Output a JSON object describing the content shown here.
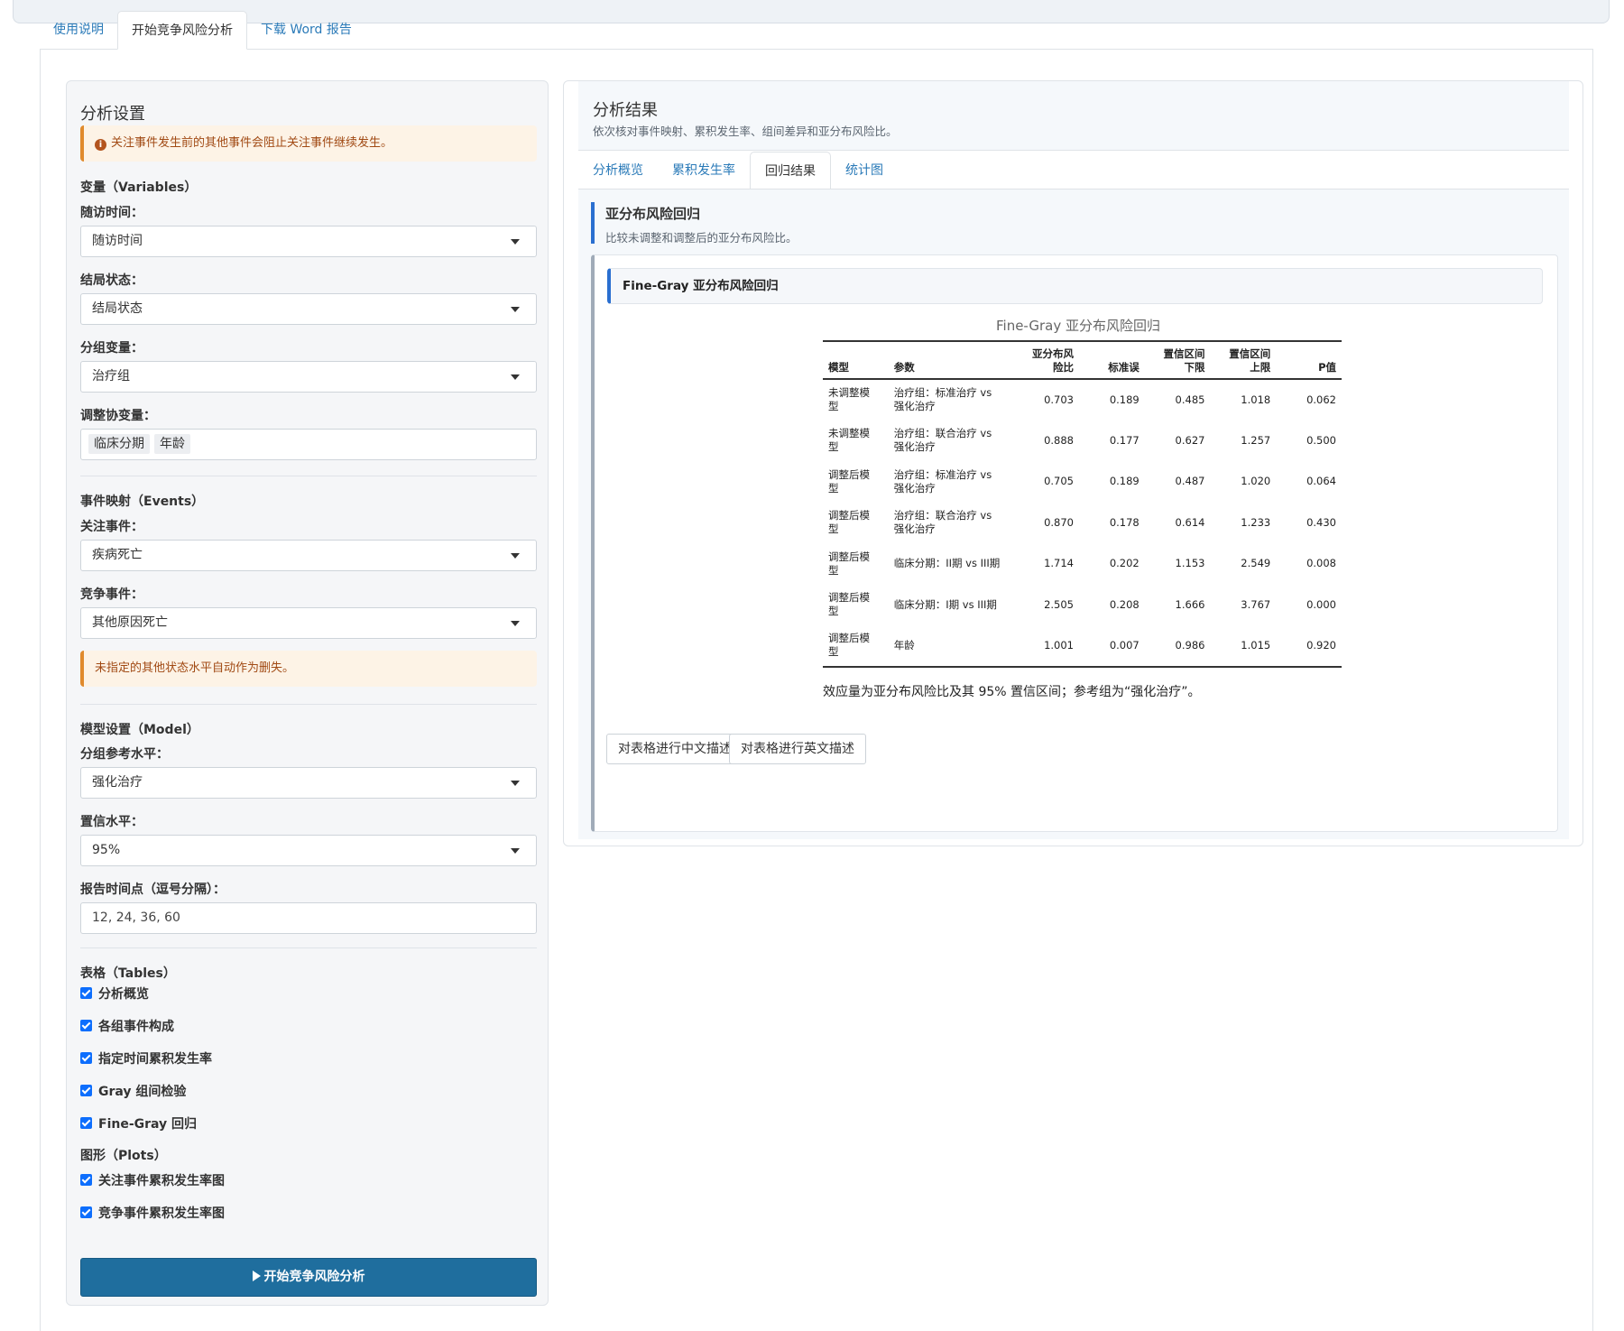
{
  "main_tabs": [
    "使用说明",
    "开始竞争风险分析",
    "下载 Word 报告"
  ],
  "sidebar": {
    "title": "分析设置",
    "alert1": "关注事件发生前的其他事件会阻止关注事件继续发生。",
    "variables_title": "变量（Variables）",
    "time_label": "随访时间：",
    "time_value": "随访时间",
    "status_label": "结局状态：",
    "status_value": "结局状态",
    "group_label": "分组变量：",
    "group_value": "治疗组",
    "covar_label": "调整协变量：",
    "covar_values": [
      "临床分期",
      "年龄"
    ],
    "events_title": "事件映射（Events）",
    "event_label": "关注事件：",
    "event_value": "疾病死亡",
    "compete_label": "竞争事件：",
    "compete_value": "其他原因死亡",
    "alert2": "未指定的其他状态水平自动作为删失。",
    "model_title": "模型设置（Model）",
    "ref_label": "分组参考水平：",
    "ref_value": "强化治疗",
    "conf_label": "置信水平：",
    "conf_value": "95%",
    "timepoints_label": "报告时间点（逗号分隔）：",
    "timepoints_value": "12, 24, 36, 60",
    "tables_title": "表格（Tables）",
    "tables": [
      "分析概览",
      "各组事件构成",
      "指定时间累积发生率",
      "Gray 组间检验",
      "Fine-Gray 回归"
    ],
    "plots_title": "图形（Plots）",
    "plots": [
      "关注事件累积发生率图",
      "竞争事件累积发生率图"
    ],
    "run_label": "开始竞争风险分析"
  },
  "results": {
    "title": "分析结果",
    "subtitle": "依次核对事件映射、累积发生率、组间差异和亚分布风险比。",
    "tabs": [
      "分析概览",
      "累积发生率",
      "回归结果",
      "统计图"
    ],
    "section_title": "亚分布风险回归",
    "section_sub": "比较未调整和调整后的亚分布风险比。",
    "card_title": "Fine-Gray 亚分布风险回归",
    "table_caption": "Fine-Gray 亚分布风险回归",
    "headers": [
      "模型",
      "参数",
      "亚分布风\n险比",
      "标准误",
      "置信区间\n下限",
      "置信区间\n上限",
      "P值"
    ],
    "rows": [
      [
        "未调整模\n型",
        "治疗组：标准治疗 vs\n强化治疗",
        "0.703",
        "0.189",
        "0.485",
        "1.018",
        "0.062"
      ],
      [
        "未调整模\n型",
        "治疗组：联合治疗 vs\n强化治疗",
        "0.888",
        "0.177",
        "0.627",
        "1.257",
        "0.500"
      ],
      [
        "调整后模\n型",
        "治疗组：标准治疗 vs\n强化治疗",
        "0.705",
        "0.189",
        "0.487",
        "1.020",
        "0.064"
      ],
      [
        "调整后模\n型",
        "治疗组：联合治疗 vs\n强化治疗",
        "0.870",
        "0.178",
        "0.614",
        "1.233",
        "0.430"
      ],
      [
        "调整后模\n型",
        "临床分期：II期 vs III期",
        "1.714",
        "0.202",
        "1.153",
        "2.549",
        "0.008"
      ],
      [
        "调整后模\n型",
        "临床分期：I期 vs III期",
        "2.505",
        "0.208",
        "1.666",
        "3.767",
        "0.000"
      ],
      [
        "调整后模\n型",
        "年龄",
        "1.001",
        "0.007",
        "0.986",
        "1.015",
        "0.920"
      ]
    ],
    "note": "效应量为亚分布风险比及其 95% 置信区间；参考组为“强化治疗”。",
    "btn_cn": "对表格进行中文描述",
    "btn_en": "对表格进行英文描述"
  }
}
